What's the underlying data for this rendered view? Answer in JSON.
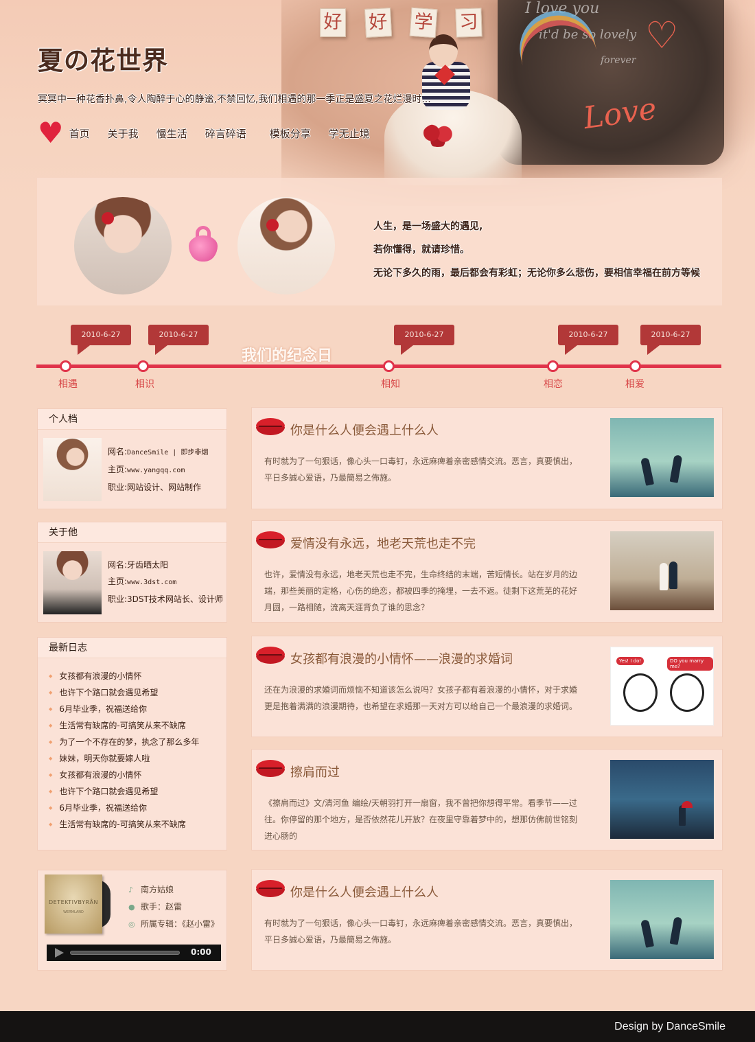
{
  "header": {
    "tiles": [
      "好",
      "好",
      "学",
      "习"
    ],
    "title": "夏の花世界",
    "tagline": "冥冥中一种花香扑鼻,令人陶醉于心的静谧,不禁回忆,我们相遇的那一季正是盛夏之花烂漫时...",
    "board_love": "Love",
    "nav": [
      "首页",
      "关于我",
      "慢生活",
      "碎言碎语",
      "模板分享",
      "学无止境"
    ]
  },
  "intro": {
    "lines": [
      "人生，是一场盛大的遇见,",
      "若你懂得，就请珍惜。",
      "无论下多久的雨，最后都会有彩虹；无论你多么悲伤，要相信幸福在前方等候"
    ]
  },
  "timeline": {
    "title": "我们的纪念日",
    "events": [
      {
        "date": "2010-6-27",
        "label": "相遇"
      },
      {
        "date": "2010-6-27",
        "label": "相识"
      },
      {
        "date": "2010-6-27",
        "label": "相知"
      },
      {
        "date": "2010-6-27",
        "label": "相恋"
      },
      {
        "date": "2010-6-27",
        "label": "相爱"
      }
    ]
  },
  "sidebar": {
    "profile_me": {
      "title": "个人档",
      "name_label": "网名:",
      "name": "DanceSmile | 即步非烟",
      "home_label": "主页:",
      "home": "www.yangqq.com",
      "job_label": "职业:",
      "job": "网站设计、网站制作"
    },
    "profile_him": {
      "title": "关于他",
      "name_label": "网名:",
      "name": "牙齿晒太阳",
      "home_label": "主页:",
      "home": "www.3dst.com",
      "job_label": "职业:",
      "job": "3DST技术网站长、设计师"
    },
    "logs": {
      "title": "最新日志",
      "items": [
        "女孩都有浪漫的小情怀",
        "也许下个路口就会遇见希望",
        "6月毕业季，祝福送给你",
        "生活常有缺席的-可搞笑从来不缺席",
        "为了一个不存在的梦，执念了那么多年",
        "妹妹，明天你就要嫁人啦",
        "女孩都有浪漫的小情怀",
        "也许下个路口就会遇见希望",
        "6月毕业季，祝福送给你",
        "生活常有缺席的-可搞笑从来不缺席"
      ]
    },
    "music": {
      "album_brand": "DETEKTIVBYRÅN",
      "album_sub": "WERMLAND",
      "song": "南方姑娘",
      "singer": "歌手：赵雷",
      "album": "所属专辑：《赵小雷》",
      "time": "0:00"
    }
  },
  "articles": [
    {
      "title": "你是什么人便会遇上什么人",
      "body": "有时就为了一句狠话，像心头一口毒钉，永远麻痺着亲密感情交流。恶言，真要慎出，平日多誠心爱语，乃最簡易之佈施。"
    },
    {
      "title": "爱情没有永远，地老天荒也走不完",
      "body": "也许，爱情没有永远，地老天荒也走不完，生命终结的末端，苦短情长。站在岁月的边端，那些美丽的定格，心伤的绝恋，都被四季的掩埋，一去不返。徒剩下这荒芜的花好月圆，一路相随，流离天涯背负了谁的思念？"
    },
    {
      "title": "女孩都有浪漫的小情怀——浪漫的求婚词",
      "body": "还在为浪漫的求婚词而烦恼不知道该怎么说吗？女孩子都有着浪漫的小情怀，对于求婚更是抱着满满的浪漫期待，也希望在求婚那一天对方可以给自己一个最浪漫的求婚词。"
    },
    {
      "title": "擦肩而过",
      "body": "《擦肩而过》文/清河鱼 编绘/天朝羽打开一扇窗，我不曾把你想得平常。看季节——过往。你停留的那个地方，是否依然花儿开放？在夜里守靠着梦中的，想那仿佛前世铭刻进心肠的"
    },
    {
      "title": "你是什么人便会遇上什么人",
      "body": "有时就为了一句狠话，像心头一口毒钉，永远麻痺着亲密感情交流。恶言，真要慎出，平日多誠心爱语，乃最簡易之佈施。"
    }
  ],
  "thumbs": {
    "cartoon_left": "Yes! I do!",
    "cartoon_right": "DO you marry me?"
  },
  "footer": {
    "text": "Design by DanceSmile"
  },
  "colors": {
    "accent": "#e0334a",
    "bubble": "#b23838",
    "page_bg": "#f7d6c3",
    "footer_bg": "#151312"
  }
}
